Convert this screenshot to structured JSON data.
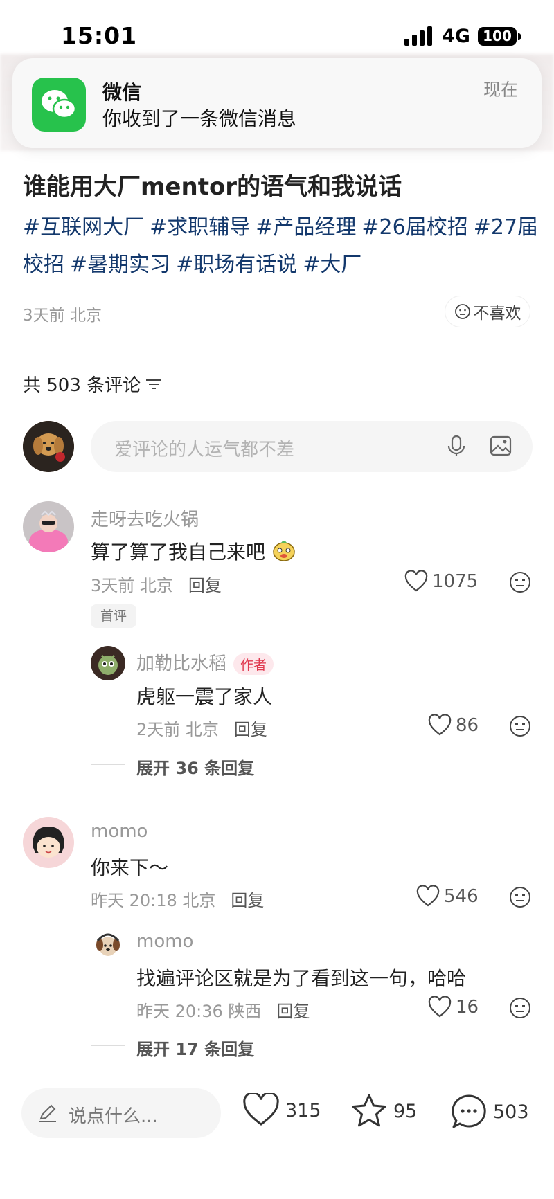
{
  "status": {
    "time": "15:01",
    "network": "4G",
    "battery": "100"
  },
  "notification": {
    "app": "微信",
    "message": "你收到了一条微信消息",
    "time": "现在"
  },
  "post": {
    "title": "谁能用大厂mentor的语气和我说话",
    "tags": [
      "#互联网大厂",
      "#求职辅导",
      "#产品经理",
      "#26届校招",
      "#27届校招",
      "#暑期实习",
      "#职场有话说",
      "#大厂"
    ],
    "meta": "3天前 北京",
    "dislike_label": "不喜欢"
  },
  "comments_header": {
    "label": "共 503 条评论"
  },
  "comment_input": {
    "placeholder": "爱评论的人运气都不差"
  },
  "comments": [
    {
      "name": "走呀去吃火锅",
      "text": "算了算了我自己来吧",
      "meta": "3天前 北京",
      "reply": "回复",
      "likes": "1075",
      "badge": "首评",
      "replies": [
        {
          "name": "加勒比水稻",
          "author_tag": "作者",
          "text": "虎躯一震了家人",
          "meta": "2天前 北京",
          "reply": "回复",
          "likes": "86"
        }
      ],
      "expand": "展开 36 条回复"
    },
    {
      "name": "momo",
      "text": "你来下～",
      "meta": "昨天 20:18 北京",
      "reply": "回复",
      "likes": "546",
      "replies": [
        {
          "name": "momo",
          "text": "找遍评论区就是为了看到这一句，哈哈",
          "meta": "昨天 20:36 陕西",
          "reply": "回复",
          "likes": "16"
        }
      ],
      "expand": "展开 17 条回复"
    }
  ],
  "bottom_bar": {
    "say_placeholder": "说点什么...",
    "likes": "315",
    "favorites": "95",
    "comments": "503"
  }
}
